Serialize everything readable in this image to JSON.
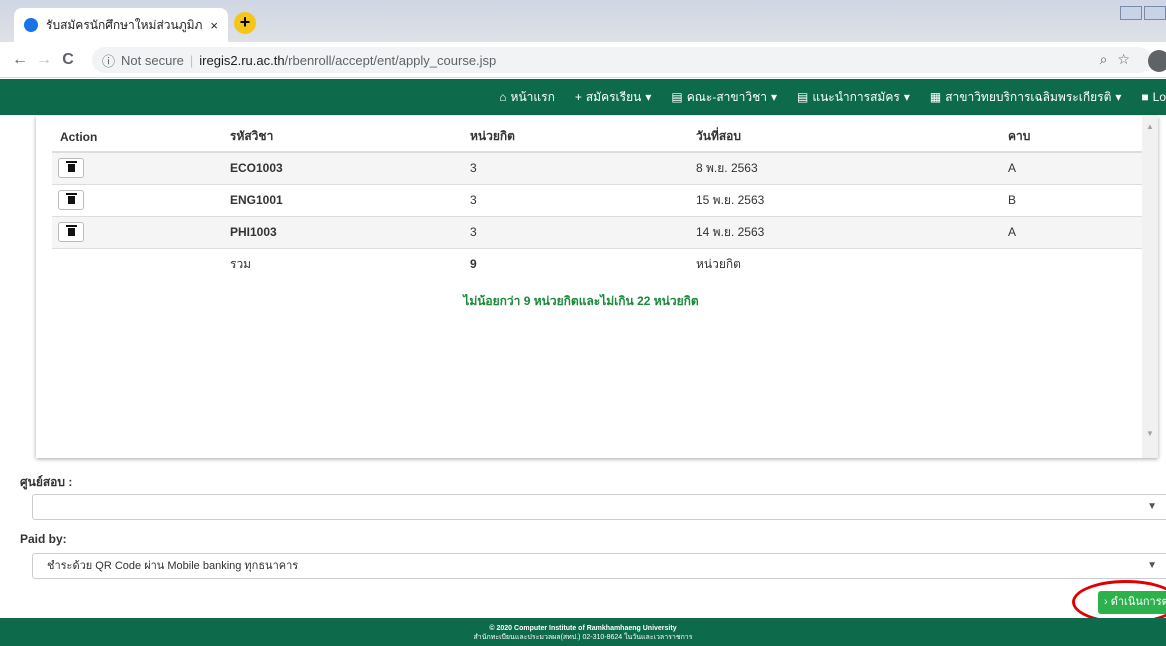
{
  "browser": {
    "tab_title": "รับสมัครนักศึกษาใหม่ส่วนภูมิภาค",
    "tab_close": "×",
    "new_tab": "+",
    "security": "Not secure",
    "url_host": "iregis2.ru.ac.th",
    "url_path": "/rbenroll/accept/ent/apply_course.jsp"
  },
  "nav": {
    "home": "หน้าแรก",
    "apply": "สมัครเรียน",
    "faculty": "คณะ-สาขาวิชา",
    "guide": "แนะนำการสมัคร",
    "campus": "สาขาวิทยบริการเฉลิมพระเกียรติ",
    "login": "Lo"
  },
  "table": {
    "headers": [
      "Action",
      "รหัสวิชา",
      "หน่วยกิต",
      "วันที่สอบ",
      "คาบ"
    ],
    "rows": [
      {
        "code": "ECO1003",
        "credits": "3",
        "exam_date": "8 พ.ย. 2563",
        "period": "A"
      },
      {
        "code": "ENG1001",
        "credits": "3",
        "exam_date": "15 พ.ย. 2563",
        "period": "B"
      },
      {
        "code": "PHI1003",
        "credits": "3",
        "exam_date": "14 พ.ย. 2563",
        "period": "A"
      }
    ],
    "total_label": "รวม",
    "total_value": "9",
    "total_unit": "หน่วยกิต",
    "note": "ไม่น้อยกว่า 9 หน่วยกิตและไม่เกิน 22 หน่วยกิต"
  },
  "form": {
    "exam_center_label": "ศูนย์สอบ :",
    "exam_center_value": "",
    "paid_by_label": "Paid by:",
    "paid_by_value": "ชำระด้วย QR Code ผ่าน Mobile banking ทุกธนาคาร",
    "next_button": "ดำเนินการต่อ"
  },
  "footer": {
    "line1": "© 2020 Computer Institute of Ramkhamhaeng University",
    "line2": "สำนักทะเบียนและประมวลผล(สทป.) 02-310-8624 ในวันและเวลาราชการ"
  },
  "colors": {
    "nav_bg": "#0d6b4b",
    "next_button": "#2bb24c",
    "note_text": "#1a8a3a",
    "highlight_ring": "#e00000"
  }
}
